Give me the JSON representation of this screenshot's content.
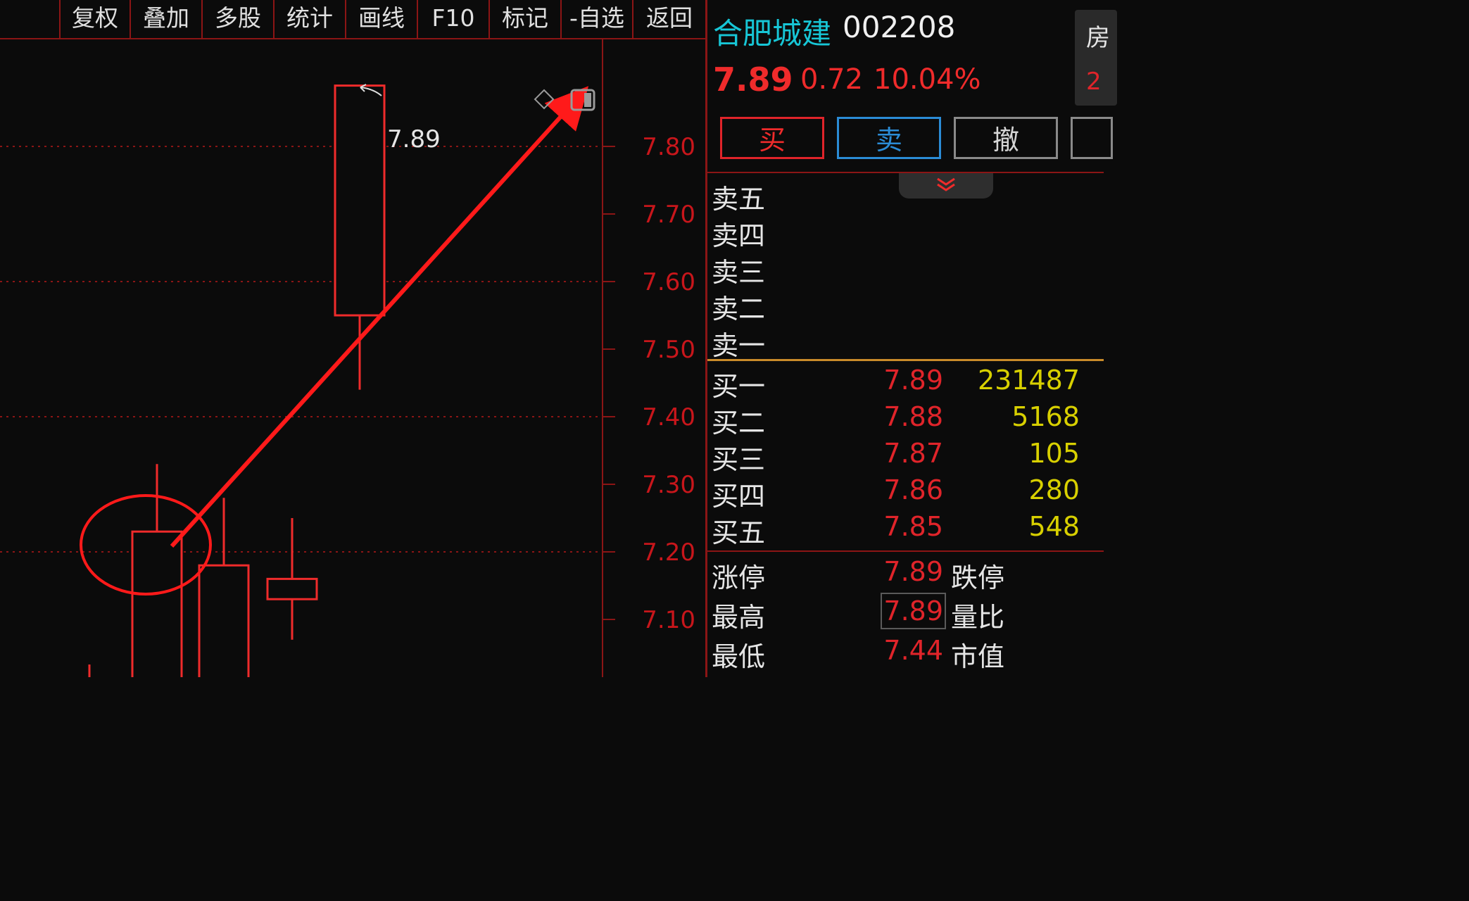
{
  "toolbar": {
    "buttons": [
      "复权",
      "叠加",
      "多股",
      "统计",
      "画线",
      "F10",
      "标记",
      "-自选",
      "返回"
    ]
  },
  "stock": {
    "name": "合肥城建",
    "code": "002208",
    "price": "7.89",
    "change": "0.72",
    "change_pct": "10.04%"
  },
  "corner": {
    "text1": "房",
    "text2": "2"
  },
  "actions": {
    "buy": "买",
    "sell": "卖",
    "cancel": "撤"
  },
  "order_book": {
    "asks": [
      {
        "label": "卖五",
        "price": "",
        "volume": ""
      },
      {
        "label": "卖四",
        "price": "",
        "volume": ""
      },
      {
        "label": "卖三",
        "price": "",
        "volume": ""
      },
      {
        "label": "卖二",
        "price": "",
        "volume": ""
      },
      {
        "label": "卖一",
        "price": "",
        "volume": ""
      }
    ],
    "bids": [
      {
        "label": "买一",
        "price": "7.89",
        "volume": "231487"
      },
      {
        "label": "买二",
        "price": "7.88",
        "volume": "5168"
      },
      {
        "label": "买三",
        "price": "7.87",
        "volume": "105"
      },
      {
        "label": "买四",
        "price": "7.86",
        "volume": "280"
      },
      {
        "label": "买五",
        "price": "7.85",
        "volume": "548"
      }
    ]
  },
  "stats": [
    {
      "label": "涨停",
      "value": "7.89",
      "label2": "跌停"
    },
    {
      "label": "最高",
      "value": "7.89",
      "label2": "量比"
    },
    {
      "label": "最低",
      "value": "7.44",
      "label2": "市值"
    }
  ],
  "colors": {
    "up": "#ef2b2b",
    "grid": "#8b1515",
    "name": "#17c6d6",
    "volume": "#d8d000",
    "arrow": "#ff1a1a"
  },
  "chart_data": {
    "type": "candlestick",
    "y_ticks": [
      "7.80",
      "7.70",
      "7.60",
      "7.50",
      "7.40",
      "7.30",
      "7.20",
      "7.10"
    ],
    "ylim": [
      7.0,
      7.9
    ],
    "candles": [
      {
        "open": 7.0,
        "close": 7.23,
        "high": 7.33,
        "low": 7.0
      },
      {
        "open": 7.0,
        "close": 7.18,
        "high": 7.28,
        "low": 7.0
      },
      {
        "open": 7.13,
        "close": 7.16,
        "high": 7.25,
        "low": 7.07
      },
      {
        "open": 7.55,
        "close": 7.89,
        "high": 7.89,
        "low": 7.44
      }
    ],
    "annotation_price": "7.89",
    "annotations": [
      "circle around first candle top",
      "arrow pointing up-right"
    ]
  }
}
